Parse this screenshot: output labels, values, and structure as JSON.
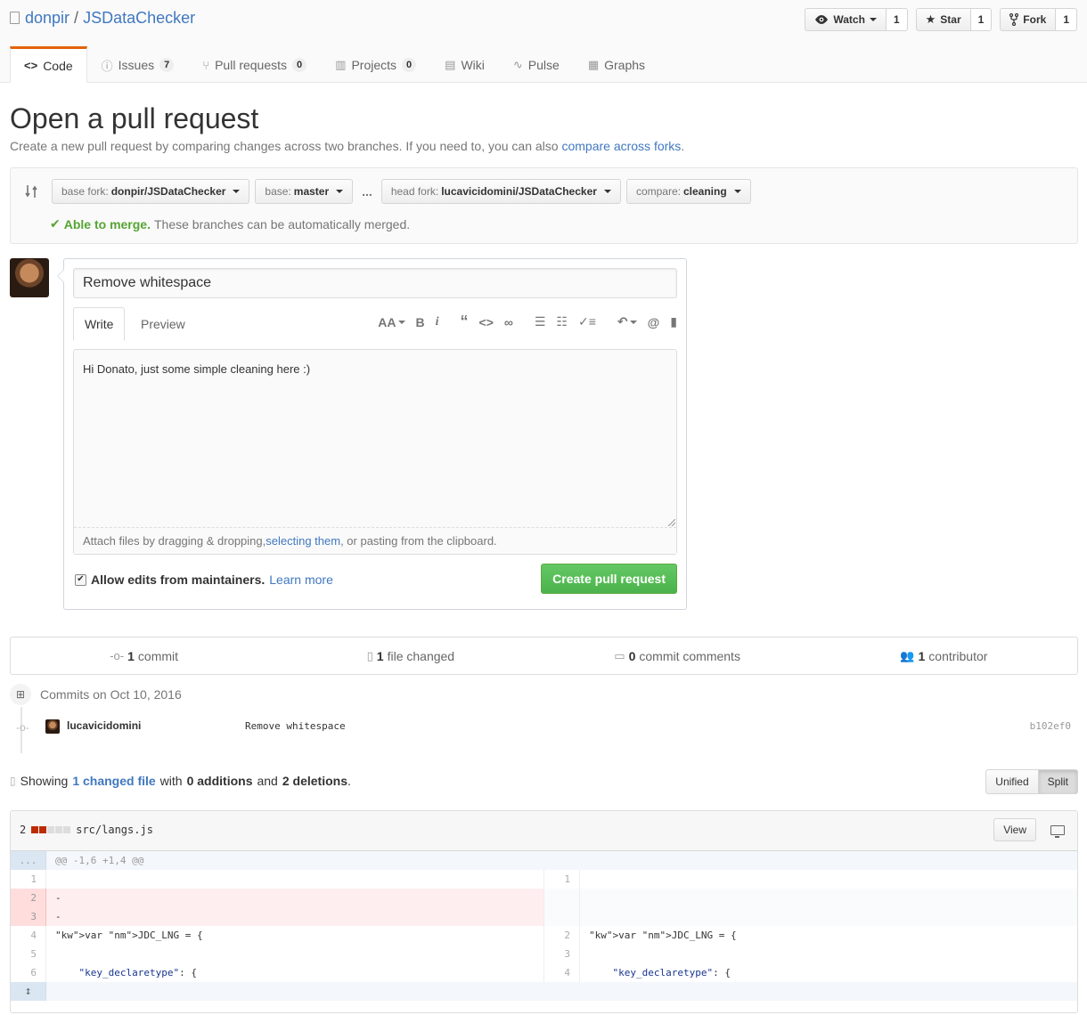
{
  "repo": {
    "owner": "donpir",
    "separator": "/",
    "name": "JSDataChecker"
  },
  "actions": {
    "watch": {
      "label": "Watch",
      "count": "1"
    },
    "star": {
      "label": "Star",
      "count": "1"
    },
    "fork": {
      "label": "Fork",
      "count": "1"
    }
  },
  "nav": {
    "code": "Code",
    "issues": {
      "label": "Issues",
      "count": "7"
    },
    "pulls": {
      "label": "Pull requests",
      "count": "0"
    },
    "projects": {
      "label": "Projects",
      "count": "0"
    },
    "wiki": "Wiki",
    "pulse": "Pulse",
    "graphs": "Graphs"
  },
  "page": {
    "title": "Open a pull request",
    "desc": "Create a new pull request by comparing changes across two branches. If you need to, you can also ",
    "desc_link": "compare across forks",
    "desc_end": "."
  },
  "range": {
    "base_fork_prefix": "base fork:",
    "base_fork_value": "donpir/JSDataChecker",
    "base_prefix": "base:",
    "base_value": "master",
    "dots": "...",
    "head_fork_prefix": "head fork:",
    "head_fork_value": "lucavicidomini/JSDataChecker",
    "compare_prefix": "compare:",
    "compare_value": "cleaning",
    "merge_ok": "Able to merge.",
    "merge_text": "These branches can be automatically merged."
  },
  "form": {
    "title_value": "Remove whitespace",
    "tab_write": "Write",
    "tab_preview": "Preview",
    "body_value": "Hi Donato, just some simple cleaning here :)",
    "attach_prefix": "Attach files by dragging & dropping, ",
    "attach_link": "selecting them",
    "attach_suffix": ", or pasting from the clipboard.",
    "allow_edits": "Allow edits from maintainers.",
    "learn_more": "Learn more",
    "submit": "Create pull request"
  },
  "summary": {
    "commits_count": "1",
    "commits_label": "commit",
    "files_count": "1",
    "files_label": "file changed",
    "comments_count": "0",
    "comments_label": "commit comments",
    "contributors_count": "1",
    "contributors_label": "contributor"
  },
  "commits": {
    "group_title": "Commits on Oct 10, 2016",
    "items": [
      {
        "author": "lucavicidomini",
        "message": "Remove whitespace",
        "sha": "b102ef0"
      }
    ]
  },
  "toc": {
    "showing": "Showing",
    "changed_link": "1 changed file",
    "with": "with",
    "additions": "0 additions",
    "and": "and",
    "deletions": "2 deletions",
    "end": ".",
    "unified": "Unified",
    "split": "Split"
  },
  "file": {
    "change_count": "2",
    "path": "src/langs.js",
    "view": "View",
    "hunk_marker": "...",
    "hunk_header": "@@ -1,6 +1,4 @@",
    "expand_icon": "↕",
    "rows": [
      {
        "l_num": "1",
        "l_code": "",
        "r_num": "1",
        "r_code": ""
      },
      {
        "l_num": "2",
        "l_code": "-",
        "r_num": "",
        "r_code": ""
      },
      {
        "l_num": "3",
        "l_code": "-",
        "r_num": "",
        "r_code": ""
      },
      {
        "l_num": "4",
        "l_code": "var JDC_LNG = {",
        "r_num": "2",
        "r_code": "var JDC_LNG = {"
      },
      {
        "l_num": "5",
        "l_code": "",
        "r_num": "3",
        "r_code": ""
      },
      {
        "l_num": "6",
        "l_code": "    \"key_declaretype\": {",
        "r_num": "4",
        "r_code": "    \"key_declaretype\": {"
      }
    ]
  },
  "colors": {
    "link": "#4078c0",
    "nav_selected_border": "#e36209",
    "merge_ok": "#55a532",
    "button_primary": "#4bb34b",
    "deletion": "#bd2c00",
    "del_bg": "#ffeef0"
  },
  "icons": {
    "repo": "repo-icon",
    "watch": "eye-icon",
    "star": "star-icon",
    "fork": "fork-icon",
    "code": "code-icon",
    "issues": "issue-icon",
    "pulls": "pull-request-icon",
    "projects": "project-icon",
    "wiki": "book-icon",
    "pulse": "pulse-icon",
    "graphs": "graph-icon"
  }
}
